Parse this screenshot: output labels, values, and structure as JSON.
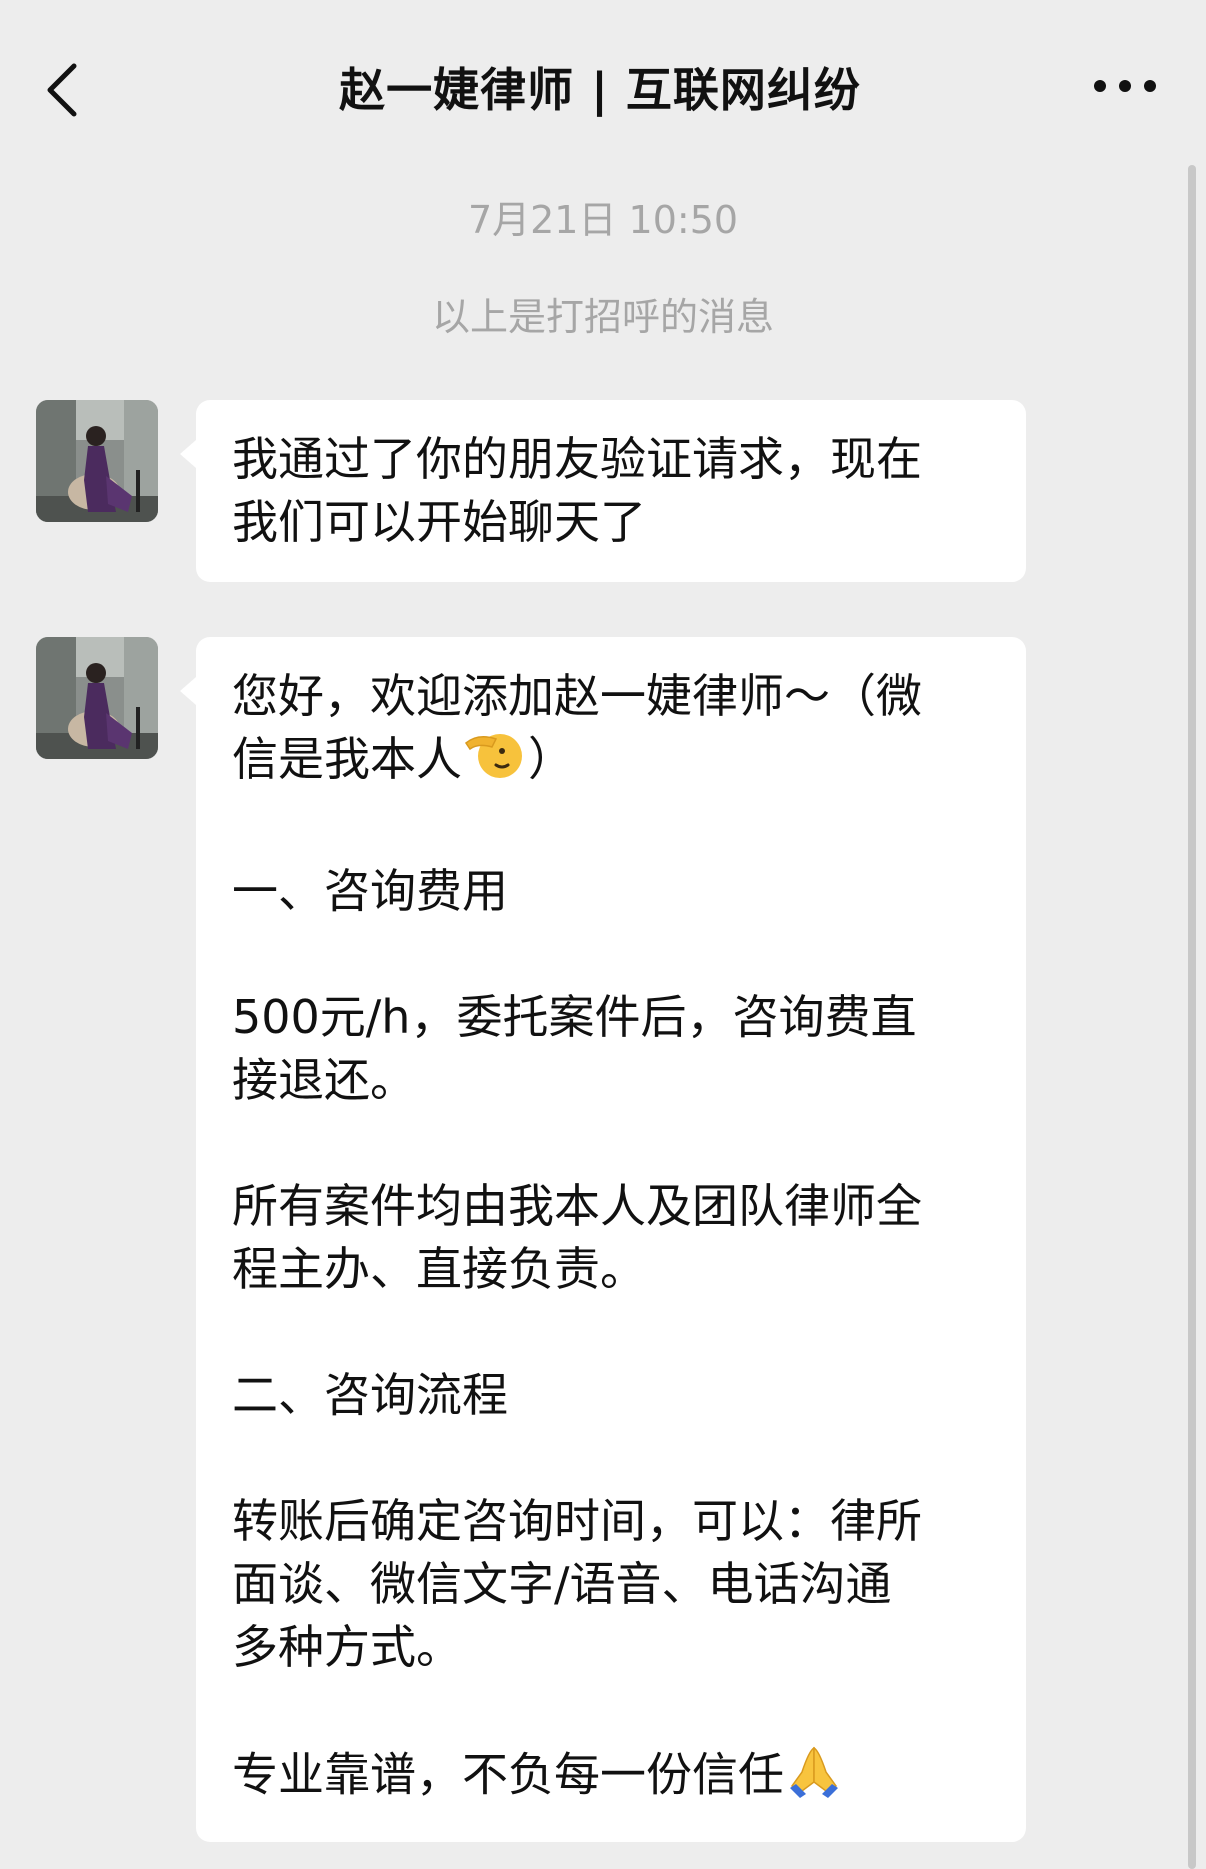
{
  "header": {
    "title": "赵一婕律师 | 互联网纠纷",
    "back_icon": "chevron-left-icon",
    "more_icon": "more-dots-icon"
  },
  "chat": {
    "timestamp": "7月21日 10:50",
    "system_note": "以上是打招呼的消息",
    "messages": [
      {
        "sender": "contact",
        "lines": [
          "我通过了你的朋友验证请求，现在",
          "我们可以开始聊天了"
        ]
      },
      {
        "sender": "contact",
        "blocks": [
          [
            "您好，欢迎添加赵一婕律师～（微",
            "信是我本人"
          ],
          [
            "一、咨询费用"
          ],
          [
            "500元/h，委托案件后，咨询费直",
            "接退还。"
          ],
          [
            "所有案件均由我本人及团队律师全",
            "程主办、直接负责。"
          ],
          [
            "二、咨询流程"
          ],
          [
            "转账后确定咨询时间，可以：律所",
            "面谈、微信文字/语音、电话沟通",
            "多种方式。"
          ],
          [
            "专业靠谱，不负每一份信任"
          ]
        ],
        "salute_suffix": "）",
        "emojis": [
          "saluting-face-icon",
          "folded-hands-icon"
        ]
      }
    ]
  },
  "colors": {
    "background": "#ededed",
    "bubble": "#ffffff",
    "meta_text": "#a6a6a6",
    "text": "#111111"
  }
}
